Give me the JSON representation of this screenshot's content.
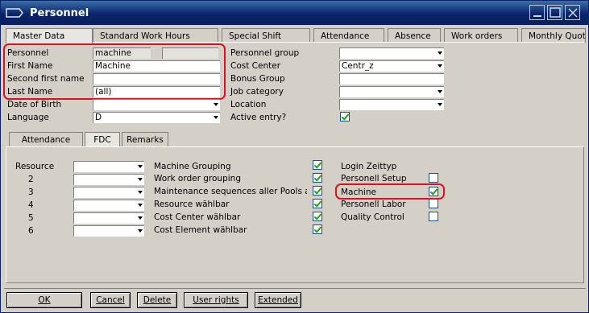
{
  "window": {
    "title": "Personnel"
  },
  "main_tabs": [
    "Master Data",
    "Standard Work Hours",
    "Special Shift",
    "Attendance",
    "Absence",
    "Work orders",
    "Monthly Quota"
  ],
  "master": {
    "personnel_label": "Personnel",
    "personnel_value": "machine",
    "first_name_label": "First Name",
    "first_name_value": "Machine",
    "second_first_name_label": "Second first name",
    "second_first_name_value": "",
    "last_name_label": "Last Name",
    "last_name_value": "(all)",
    "date_of_birth_label": "Date of Birth",
    "date_of_birth_value": "",
    "language_label": "Language",
    "language_value": "D",
    "personnel_group_label": "Personnel group",
    "personnel_group_value": "",
    "cost_center_label": "Cost Center",
    "cost_center_value": "Centr_z",
    "bonus_group_label": "Bonus Group",
    "bonus_group_value": "",
    "job_category_label": "Job category",
    "job_category_value": "",
    "location_label": "Location",
    "location_value": "",
    "active_entry_label": "Active entry?",
    "active_entry_checked": true
  },
  "sub_tabs": [
    "Attendance",
    "FDC",
    "Remarks"
  ],
  "fdc": {
    "resource_label": "Resource",
    "row_numbers": [
      "2",
      "3",
      "4",
      "5",
      "6"
    ],
    "permissions": [
      {
        "label": "Machine Grouping",
        "checked": true
      },
      {
        "label": "Work order grouping",
        "checked": true
      },
      {
        "label": "Maintenance sequences aller Pools anr",
        "checked": true
      },
      {
        "label": "Resource wählbar",
        "checked": true
      },
      {
        "label": "Cost Center wählbar",
        "checked": true
      },
      {
        "label": "Cost Element wählbar",
        "checked": true
      }
    ],
    "login_label": "Login Zeittyp",
    "roles": [
      {
        "label": "Personell Setup",
        "checked": false
      },
      {
        "label": "Machine",
        "checked": true
      },
      {
        "label": "Personell Labor",
        "checked": false
      },
      {
        "label": "Quality Control",
        "checked": false
      }
    ]
  },
  "buttons": {
    "ok": "OK",
    "cancel": "Cancel",
    "delete": "Delete",
    "user_rights": "User rights",
    "extended": "Extended"
  },
  "colors": {
    "titlebar": "#0a246a",
    "highlight": "#e0101a",
    "check": "#21a121"
  }
}
